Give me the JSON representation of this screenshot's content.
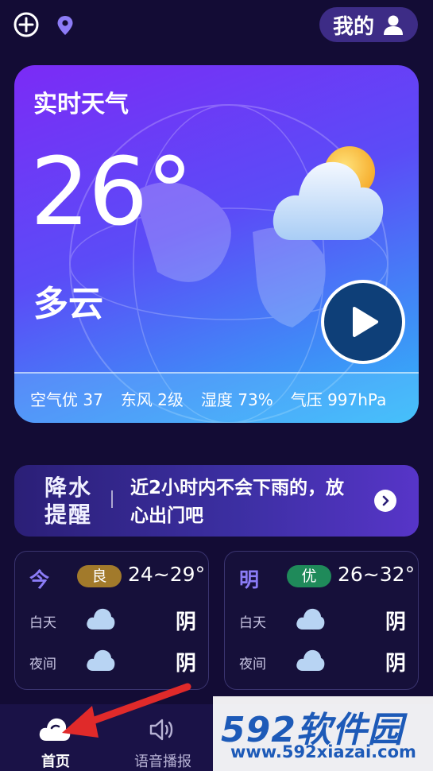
{
  "topbar": {
    "add_icon": "plus-circle-icon",
    "location_icon": "location-pin-icon",
    "mine_label": "我的",
    "mine_icon": "user-icon"
  },
  "realtime": {
    "title": "实时天气",
    "temperature": "26°",
    "condition": "多云",
    "icon": "partly-cloudy-icon",
    "play_icon": "play-icon",
    "air": "空气优 37",
    "wind": "东风 2级",
    "humidity": "湿度 73%",
    "pressure": "气压 997hPa"
  },
  "rain_reminder": {
    "tag_line1": "降水",
    "tag_line2": "提醒",
    "text_line1": "近2小时内不会下雨的，放",
    "text_line2": "心出门吧",
    "arrow_icon": "chevron-right-icon"
  },
  "forecast": [
    {
      "day": "今",
      "aqi": "良",
      "range": "24~29°",
      "daytime_label": "白天",
      "daytime_desc": "阴",
      "night_label": "夜间",
      "night_desc": "阴"
    },
    {
      "day": "明",
      "aqi": "优",
      "range": "26~32°",
      "daytime_label": "白天",
      "daytime_desc": "阴",
      "night_label": "夜间",
      "night_desc": "阴"
    }
  ],
  "nav": {
    "home_label": "首页",
    "home_icon": "cloud-icon",
    "voice_label": "语音播报",
    "voice_icon": "speaker-icon"
  },
  "watermark": {
    "logo": "592软件园",
    "url": "www.592xiazai.com"
  },
  "colors": {
    "background": "#130c35",
    "card_gradient_start": "#7b2bf6",
    "card_gradient_end": "#33b7f8",
    "aqi_good": "#a27a2b",
    "aqi_excellent": "#1f8a5a",
    "annotation_arrow": "#e02a2a"
  }
}
